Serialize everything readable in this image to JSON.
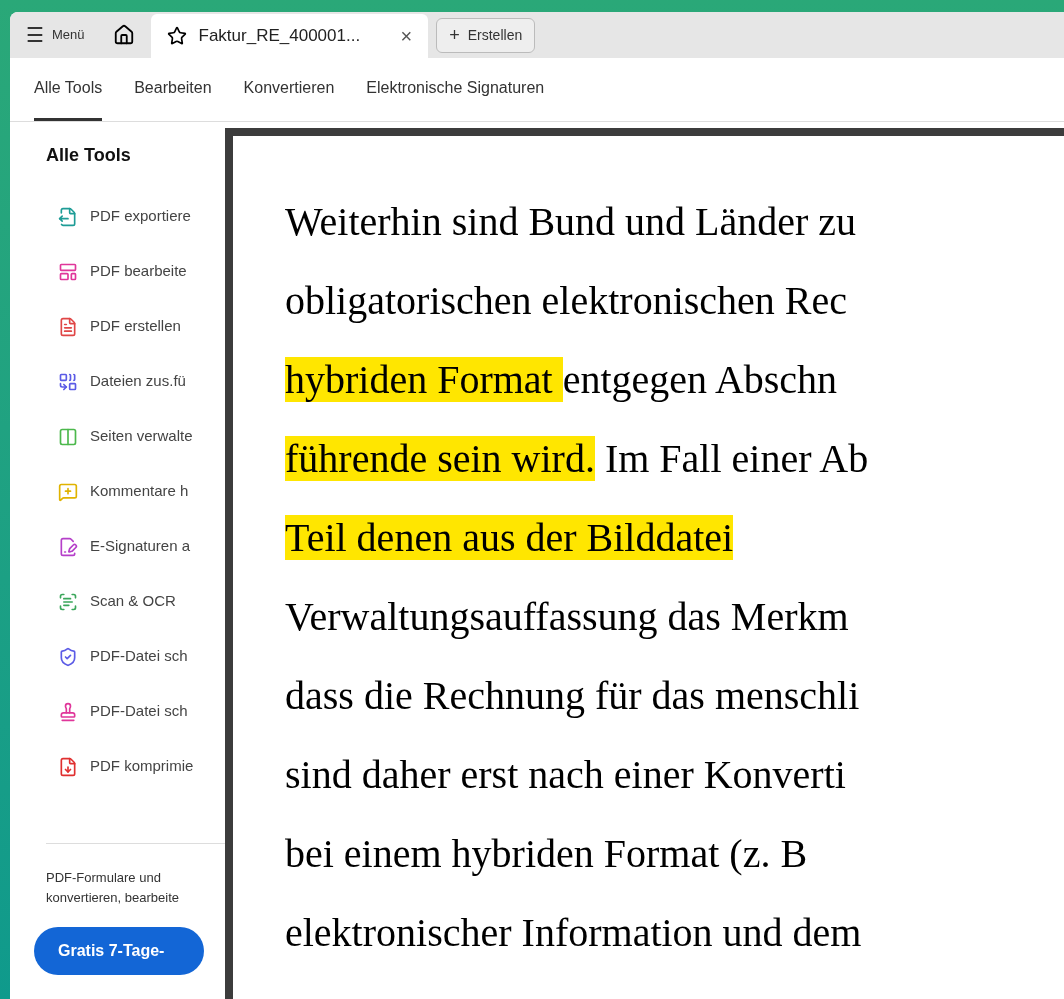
{
  "tab_bar": {
    "menu": {
      "icon": "☰",
      "label": "Menü"
    },
    "tabs": [
      {
        "label": "Faktur_RE_400001...",
        "close": "×",
        "selected": true
      }
    ],
    "create_button": {
      "icon": "+",
      "label": "Erstellen"
    }
  },
  "toolbar_tabs": [
    {
      "label": "Alle Tools",
      "selected": true
    },
    {
      "label": "Bearbeiten",
      "selected": false
    },
    {
      "label": "Konvertieren",
      "selected": false
    },
    {
      "label": "Elektronische Signaturen",
      "selected": false
    }
  ],
  "sidebar": {
    "title": "Alle Tools",
    "items": [
      {
        "label": "PDF exportiere",
        "color": "#1e9c96"
      },
      {
        "label": "PDF bearbeite",
        "color": "#e0369a"
      },
      {
        "label": "PDF erstellen",
        "color": "#e04646"
      },
      {
        "label": "Dateien zus.fü",
        "color": "#5b5be6"
      },
      {
        "label": "Seiten verwalte",
        "color": "#4cb84c"
      },
      {
        "label": "Kommentare h",
        "color": "#e0b300"
      },
      {
        "label": "E-Signaturen a",
        "color": "#b53fc9"
      },
      {
        "label": "Scan & OCR",
        "color": "#3aa65a"
      },
      {
        "label": "PDF-Datei sch",
        "color": "#5b5be6"
      },
      {
        "label": "PDF-Datei sch",
        "color": "#e0369a"
      },
      {
        "label": "PDF komprimie",
        "color": "#e03030"
      }
    ],
    "promo_lines": [
      "PDF-Formulare und",
      "konvertieren, bearbeite"
    ],
    "trial_button": "Gratis 7-Tage-"
  },
  "magnifier": {
    "lines": [
      [
        {
          "text": "Weiterhin sind Bund und Länder zu",
          "highlighted": false
        }
      ],
      [
        {
          "text": "obligatorischen elektronischen Rec",
          "highlighted": false
        }
      ],
      [
        {
          "text": "hybriden Format ",
          "highlighted": true
        },
        {
          "text": "entgegen Abschn",
          "highlighted": false
        }
      ],
      [
        {
          "text": "führende sein wird.",
          "highlighted": true
        },
        {
          "text": " Im Fall einer Ab",
          "highlighted": false
        }
      ],
      [
        {
          "text": "Teil denen aus der Bilddatei",
          "highlighted": true
        }
      ],
      [
        {
          "text": "Verwaltungsauffassung das Merkm",
          "highlighted": false
        }
      ],
      [
        {
          "text": "dass die Rechnung für das menschli",
          "highlighted": false
        }
      ],
      [
        {
          "text": "sind daher erst nach einer Konverti",
          "highlighted": false
        }
      ],
      [
        {
          "text": "bei einem hybriden Format (z. B",
          "highlighted": false
        }
      ],
      [
        {
          "text": "elektronischer Information und dem",
          "highlighted": false
        }
      ]
    ]
  }
}
